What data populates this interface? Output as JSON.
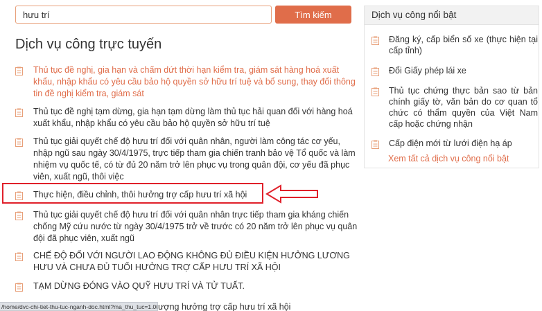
{
  "search": {
    "value": "hưu trí",
    "button_label": "Tìm kiếm"
  },
  "main": {
    "title": "Dịch vụ công trực tuyến",
    "items": [
      {
        "label": "Thủ tục đề nghị, gia hạn và chấm dứt thời hạn kiểm tra, giám sát hàng hoá xuất khẩu, nhập khẩu có yêu cầu bảo hộ quyền sở hữu trí tuệ và bổ sung, thay đổi thông tin đề nghị kiểm tra, giám sát"
      },
      {
        "label": "Thủ tục đề nghị tạm dừng, gia hạn tạm dừng làm thủ tục hải quan đối với hàng hoá xuất khẩu, nhập khẩu có yêu cầu bảo hộ quyền sở hữu trí tuệ"
      },
      {
        "label": "Thủ tục giải quyết chế độ hưu trí đối với quân nhân, người làm công tác cơ yếu, nhập ngũ sau ngày 30/4/1975, trực tiếp tham gia chiến tranh bảo vệ Tổ quốc và làm nhiệm vụ quốc tế, có từ đủ 20 năm trở lên phục vụ trong quân đội, cơ yếu đã phục viên, xuất ngũ, thôi việc"
      },
      {
        "label": "Thực hiện, điều chỉnh, thôi hưởng trợ cấp hưu trí xã hội"
      },
      {
        "label": "Thủ tục giải quyết chế độ hưu trí đối với quân nhân trực tiếp tham gia kháng chiến chống Mỹ cứu nước từ ngày 30/4/1975 trở về trước có 20 năm trở lên phục vụ quân đội đã phục viên, xuất ngũ"
      },
      {
        "label": "CHẾ ĐỘ ĐỐI VỚI NGƯỜI LAO ĐỘNG KHÔNG ĐỦ ĐIỀU KIỆN HƯỞNG LƯƠNG HƯU VÀ CHƯA ĐỦ TUỔI HƯỞNG TRỢ CẤP HƯU TRÍ XÃ HỘI"
      },
      {
        "label": "TẠM DỪNG ĐÓNG VÀO QUỸ HƯU TRÍ VÀ TỬ TUẤT."
      },
      {
        "label": "ượng hưởng trợ cấp hưu trí xã hội"
      }
    ]
  },
  "sidebar": {
    "title": "Dịch vụ công nổi bật",
    "items": [
      {
        "label": "Đăng ký, cấp biển số xe (thực hiện tại cấp tỉnh)"
      },
      {
        "label": "Đổi Giấy phép lái xe"
      },
      {
        "label": "Thủ tục chứng thực bản sao từ bản chính giấy tờ, văn bản do cơ quan tổ chức có thẩm quyền của Việt Nam cấp hoặc chứng nhận"
      },
      {
        "label": "Cấp điện mới từ lưới điện hạ áp"
      }
    ],
    "see_all": "Xem tất cả dịch vụ công nổi bật"
  },
  "status_bar": {
    "url": "/home/dvc-chi-tiet-thu-tuc-nganh-doc.html?ma_thu_tuc=1.0077..."
  },
  "colors": {
    "accent": "#e06d4a",
    "highlight_border": "#e0202a",
    "icon": "#e8a07a"
  }
}
